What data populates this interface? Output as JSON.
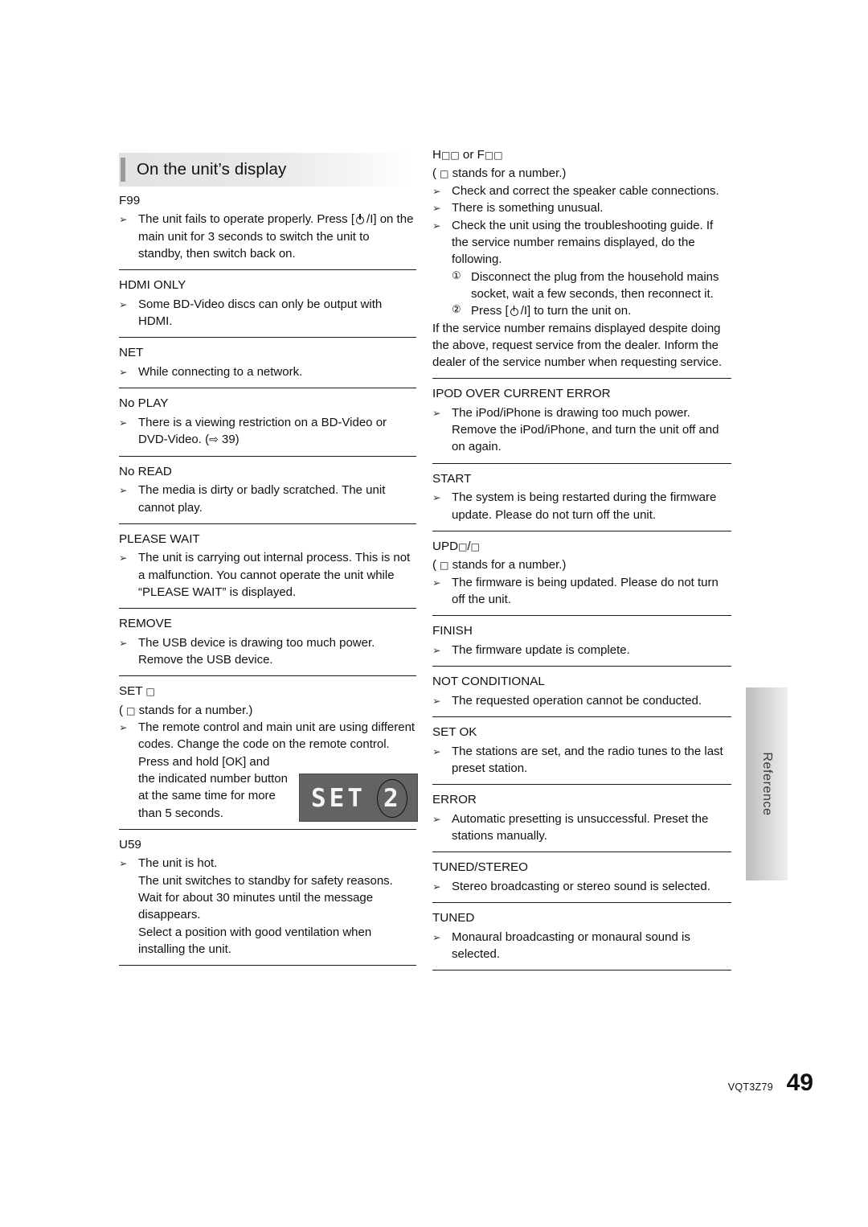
{
  "heading": {
    "title": "On the unit’s display"
  },
  "left_column": [
    {
      "title": "F99",
      "lines": [
        {
          "kind": "bullet",
          "text": "The unit fails to operate properly. Press [⏻/I] on the main unit for 3 seconds to switch the unit to standby, then switch back on."
        }
      ]
    },
    {
      "title": "HDMI ONLY",
      "lines": [
        {
          "kind": "bullet",
          "text": "Some BD-Video discs can only be output with HDMI."
        }
      ]
    },
    {
      "title": "NET",
      "lines": [
        {
          "kind": "bullet",
          "text": "While connecting to a network."
        }
      ]
    },
    {
      "title": "No PLAY",
      "lines": [
        {
          "kind": "bullet",
          "text": "There is a viewing restriction on a BD-Video or DVD-Video. (⇨ 39)"
        }
      ]
    },
    {
      "title": "No READ",
      "lines": [
        {
          "kind": "bullet",
          "text": "The media is dirty or badly scratched. The unit cannot play."
        }
      ]
    },
    {
      "title": "PLEASE WAIT",
      "lines": [
        {
          "kind": "bullet",
          "text": "The unit is carrying out internal process. This is not a malfunction. You cannot operate the unit while “PLEASE WAIT” is displayed."
        }
      ]
    },
    {
      "title": "REMOVE",
      "lines": [
        {
          "kind": "bullet",
          "text": "The USB device is drawing too much power. Remove the USB device."
        }
      ]
    },
    {
      "title": "SET □",
      "lines": [
        {
          "kind": "plain",
          "text": "( □  stands for a number.)"
        },
        {
          "kind": "bullet",
          "text": "The remote control and main unit are using different codes. Change the code on the remote control."
        },
        {
          "kind": "indent",
          "text": "Press and hold [OK] and the indicated number button at the same time for more than 5 seconds."
        }
      ]
    },
    {
      "title": "U59",
      "lines": [
        {
          "kind": "bullet",
          "text": "The unit is hot."
        },
        {
          "kind": "indent",
          "text": "The unit switches to standby for safety reasons. Wait for about 30 minutes until the message disappears."
        },
        {
          "kind": "indent",
          "text": "Select a position with good ventilation when installing the unit."
        }
      ]
    }
  ],
  "right_column": [
    {
      "title": "H□□ or F□□",
      "lines": [
        {
          "kind": "plain",
          "text": "( □  stands for a number.)"
        },
        {
          "kind": "bullet",
          "text": "Check and correct the speaker cable connections."
        },
        {
          "kind": "bullet",
          "text": "There is something unusual."
        },
        {
          "kind": "bullet",
          "text": "Check the unit using the troubleshooting guide. If the service number remains displayed, do the following."
        },
        {
          "kind": "numbered",
          "num": "1",
          "text": "Disconnect the plug from the household mains socket, wait a few seconds, then reconnect it."
        },
        {
          "kind": "numbered",
          "num": "2",
          "text": "Press [⏻/I] to turn the unit on."
        },
        {
          "kind": "plain",
          "text": "If the service number remains displayed despite doing the above, request service from the dealer. Inform the dealer of the service number when requesting service."
        }
      ]
    },
    {
      "title": "IPOD OVER CURRENT ERROR",
      "lines": [
        {
          "kind": "bullet",
          "text": "The iPod/iPhone is drawing too much power. Remove the iPod/iPhone, and turn the unit off and on again."
        }
      ]
    },
    {
      "title": "START",
      "lines": [
        {
          "kind": "bullet",
          "text": "The system is being restarted during the firmware update. Please do not turn off the unit."
        }
      ]
    },
    {
      "title": "UPD□/□",
      "lines": [
        {
          "kind": "plain",
          "text": "( □  stands for a number.)"
        },
        {
          "kind": "bullet",
          "text": "The firmware is being updated. Please do not turn off the unit."
        }
      ]
    },
    {
      "title": "FINISH",
      "lines": [
        {
          "kind": "bullet",
          "text": "The firmware update is complete."
        }
      ]
    },
    {
      "title": "NOT CONDITIONAL",
      "lines": [
        {
          "kind": "bullet",
          "text": "The requested operation cannot be conducted."
        }
      ]
    },
    {
      "title": "SET OK",
      "lines": [
        {
          "kind": "bullet",
          "text": "The stations are set, and the radio tunes to the last preset station."
        }
      ]
    },
    {
      "title": "ERROR",
      "lines": [
        {
          "kind": "bullet",
          "text": "Automatic presetting is unsuccessful. Preset the stations manually."
        }
      ]
    },
    {
      "title": "TUNED/STEREO",
      "lines": [
        {
          "kind": "bullet",
          "text": "Stereo broadcasting or stereo sound is selected."
        }
      ]
    },
    {
      "title": "TUNED",
      "lines": [
        {
          "kind": "bullet",
          "text": "Monaural broadcasting or monaural sound is selected."
        }
      ]
    }
  ],
  "display_image": {
    "segment_text": "SET",
    "digit": "2"
  },
  "side_tab": {
    "label": "Reference"
  },
  "footer": {
    "doc_code": "VQT3Z79",
    "page_number": "49"
  }
}
